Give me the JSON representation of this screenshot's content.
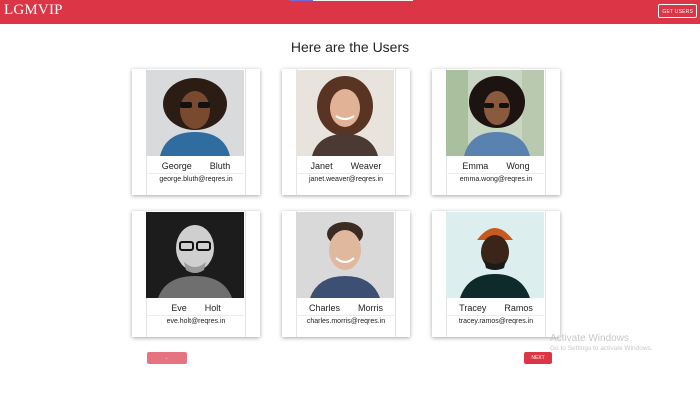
{
  "nav": {
    "brand": "LGMVIP",
    "get_users_label": "GET USERS",
    "accent": "#dc3545"
  },
  "heading": "Here are the Users",
  "users": [
    {
      "first": "George",
      "last": "Bluth",
      "email": "george.bluth@reqres.in"
    },
    {
      "first": "Janet",
      "last": "Weaver",
      "email": "janet.weaver@reqres.in"
    },
    {
      "first": "Emma",
      "last": "Wong",
      "email": "emma.wong@reqres.in"
    },
    {
      "first": "Eve",
      "last": "Holt",
      "email": "eve.holt@reqres.in"
    },
    {
      "first": "Charles",
      "last": "Morris",
      "email": "charles.morris@reqres.in"
    },
    {
      "first": "Tracey",
      "last": "Ramos",
      "email": "tracey.ramos@reqres.in"
    }
  ],
  "pagination": {
    "previous_label": "← PREVIOUS",
    "next_label": "NEXT →"
  },
  "watermark": {
    "title": "Activate Windows",
    "subtitle": "Go to Settings to activate Windows."
  }
}
